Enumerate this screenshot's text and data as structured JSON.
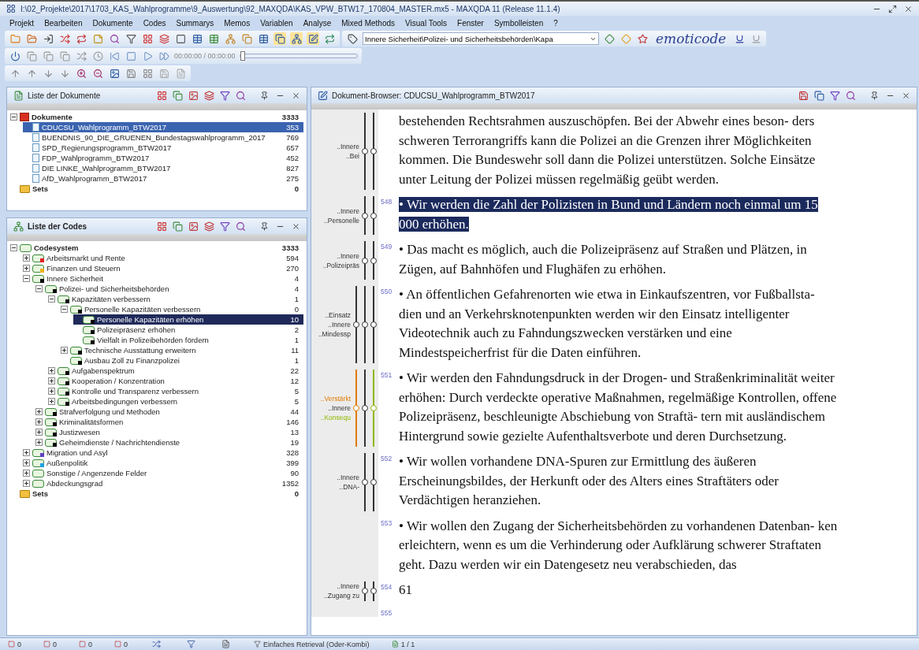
{
  "window": {
    "title": "I:\\02_Projekte\\2017\\1703_KAS_Wahlprogramme\\9_Auswertung\\92_MAXQDA\\KAS_VPW_BTW17_170804_MASTER.mx5 - MAXQDA 11 (Release 11.1.4)"
  },
  "menu": [
    "Projekt",
    "Bearbeiten",
    "Dokumente",
    "Codes",
    "Summarys",
    "Memos",
    "Variablen",
    "Analyse",
    "Mixed Methods",
    "Visual Tools",
    "Fenster",
    "Symbolleisten",
    "?"
  ],
  "toolbar": {
    "code_combo": "Innere Sicherheit\\Polizei- und Sicherheitsbehörden\\Kapa",
    "logo": "emoticode",
    "media_time": "00:00:00 / 00:00:00",
    "media_slider": {
      "level": 0
    }
  },
  "documents_panel": {
    "title": "Liste der Dokumente",
    "tree": [
      {
        "kind": "documents",
        "name": "Dokumente",
        "count": "3333",
        "expanded": true,
        "selected": false,
        "children": [
          {
            "kind": "document",
            "name": "CDUCSU_Wahlprogramm_BTW2017",
            "count": "353",
            "selected": true
          },
          {
            "kind": "document",
            "name": "BUENDNIS_90_DIE_GRUENEN_Bundestagswahlprogramm_2017",
            "count": "769",
            "selected": false
          },
          {
            "kind": "document",
            "name": "SPD_Regierungsprogramm_BTW2017",
            "count": "657",
            "selected": false
          },
          {
            "kind": "document",
            "name": "FDP_Wahlprogramm_BTW2017",
            "count": "452",
            "selected": false
          },
          {
            "kind": "document",
            "name": "DIE LINKE_Wahlprogramm_BTW2017",
            "count": "827",
            "selected": false
          },
          {
            "kind": "document",
            "name": "AfD_Wahlprogramm_BTW2017",
            "count": "275",
            "selected": false
          }
        ]
      },
      {
        "kind": "sets",
        "name": "Sets",
        "count": "0",
        "selected": false
      }
    ]
  },
  "codes_panel": {
    "title": "Liste der Codes",
    "tree": [
      {
        "kind": "codesystem",
        "name": "Codesystem",
        "count": "3333",
        "expanded": true,
        "selected": false,
        "children": [
          {
            "kind": "code",
            "name": "Arbeitsmarkt und Rente",
            "count": "594",
            "color": "#e02020",
            "expanded": false,
            "selected": false
          },
          {
            "kind": "code",
            "name": "Finanzen und Steuern",
            "count": "270",
            "color": "#f0b020",
            "expanded": false,
            "selected": false
          },
          {
            "kind": "code",
            "name": "Innere Sicherheit",
            "count": "4",
            "color": "#000000",
            "expanded": true,
            "selected": false,
            "children": [
              {
                "kind": "code",
                "name": "Polizei- und Sicherheitsbehörden",
                "count": "4",
                "color": "#000000",
                "expanded": true,
                "selected": false,
                "children": [
                  {
                    "kind": "code",
                    "name": "Kapazitäten verbessern",
                    "count": "1",
                    "color": "#000000",
                    "expanded": true,
                    "selected": false,
                    "children": [
                      {
                        "kind": "code",
                        "name": "Personelle Kapazitäten verbessern",
                        "count": "0",
                        "color": "#000000",
                        "expanded": true,
                        "selected": false,
                        "children": [
                          {
                            "kind": "code",
                            "name": "Personelle Kapazitäten erhöhen",
                            "count": "10",
                            "color": "#000000",
                            "selected": true
                          },
                          {
                            "kind": "code",
                            "name": "Polizeipräsenz erhöhen",
                            "count": "2",
                            "color": "#000000",
                            "selected": false
                          },
                          {
                            "kind": "code",
                            "name": "Vielfalt in Polizeibehörden fördern",
                            "count": "1",
                            "color": "#000000",
                            "selected": false
                          }
                        ]
                      },
                      {
                        "kind": "code",
                        "name": "Technische Ausstattung erweitern",
                        "count": "11",
                        "color": "#000000",
                        "expanded": false,
                        "selected": false
                      },
                      {
                        "kind": "code",
                        "name": "Ausbau Zoll zu Finanzpolizei",
                        "count": "1",
                        "color": "#000000",
                        "selected": false
                      }
                    ]
                  },
                  {
                    "kind": "code",
                    "name": "Aufgabenspektrum",
                    "count": "22",
                    "color": "#000000",
                    "expanded": false,
                    "selected": false
                  },
                  {
                    "kind": "code",
                    "name": "Kooperation / Konzentration",
                    "count": "12",
                    "color": "#000000",
                    "expanded": false,
                    "selected": false
                  },
                  {
                    "kind": "code",
                    "name": "Kontrolle und Transparenz verbessern",
                    "count": "5",
                    "color": "#000000",
                    "expanded": false,
                    "selected": false
                  },
                  {
                    "kind": "code",
                    "name": "Arbeitsbedingungen verbessern",
                    "count": "5",
                    "color": "#000000",
                    "expanded": false,
                    "selected": false
                  }
                ]
              },
              {
                "kind": "code",
                "name": "Strafverfolgung und Methoden",
                "count": "44",
                "color": "#000000",
                "expanded": false,
                "selected": false
              },
              {
                "kind": "code",
                "name": "Kriminalitätsformen",
                "count": "146",
                "color": "#000000",
                "expanded": false,
                "selected": false
              },
              {
                "kind": "code",
                "name": "Justizwesen",
                "count": "13",
                "color": "#000000",
                "expanded": false,
                "selected": false
              },
              {
                "kind": "code",
                "name": "Geheimdienste / Nachrichtendienste",
                "count": "19",
                "color": "#000000",
                "expanded": false,
                "selected": false
              }
            ]
          },
          {
            "kind": "code",
            "name": "Migration und Asyl",
            "count": "328",
            "color": "#6040c0",
            "expanded": false,
            "selected": false
          },
          {
            "kind": "code",
            "name": "Außenpolitik",
            "count": "399",
            "color": "#20a0e0",
            "expanded": false,
            "selected": false
          },
          {
            "kind": "code",
            "name": "Sonstige / Angenzende Felder",
            "count": "90",
            "expanded": false,
            "selected": false
          },
          {
            "kind": "code",
            "name": "Abdeckungsgrad",
            "count": "1352",
            "expanded": false,
            "selected": false
          }
        ]
      },
      {
        "kind": "sets",
        "name": "Sets",
        "count": "0",
        "selected": false
      }
    ]
  },
  "browser": {
    "title": "Dokument-Browser: CDUCSU_Wahlprogramm_BTW2017",
    "paragraphs": [
      {
        "selected": false,
        "codes": [
          {
            "text": "..Innere",
            "color": "#333333"
          },
          {
            "text": "..Bei",
            "color": "#333333"
          }
        ],
        "lines": [
          "bestehenden Rechtsrahmen auszuschöpfen. Bei der Abwehr eines beson- ders",
          "schweren Terrorangriffs kann die Polizei an die Grenzen ihrer Möglichkeiten",
          "kommen. Die Bundeswehr soll dann die Polizei unterstützen. Solche Einsätze",
          "unter Leitung der Polizei müssen regelmäßig geübt werden."
        ]
      },
      {
        "number": "548",
        "selected": true,
        "codes": [
          {
            "text": "..Innere",
            "color": "#333333"
          },
          {
            "text": "..Personelle",
            "color": "#333333"
          }
        ],
        "lines": [
          "• Wir werden die Zahl der Polizisten in Bund und Ländern noch einmal um 15",
          "000 erhöhen."
        ]
      },
      {
        "number": "549",
        "selected": false,
        "codes": [
          {
            "text": "..Innere",
            "color": "#333333"
          },
          {
            "text": "..Polizeipräs",
            "color": "#333333"
          }
        ],
        "lines": [
          "• Das macht es möglich, auch die Polizeipräsenz auf Straßen und Plätzen, in",
          "Zügen, auf Bahnhöfen und Flughäfen zu erhöhen."
        ]
      },
      {
        "number": "550",
        "selected": false,
        "codes": [
          {
            "text": "..Einsatz",
            "color": "#333333"
          },
          {
            "text": "..Innere",
            "color": "#333333"
          },
          {
            "text": "..Mindessp",
            "color": "#333333"
          }
        ],
        "lines": [
          "• An öffentlichen Gefahrenorten wie etwa in Einkaufszentren, vor Fußballsta-",
          "dien und an Verkehrsknotenpunkten werden wir den Einsatz intelligenter",
          "Videotechnik auch zu Fahndungszwecken verstärken und eine",
          "Mindestspeicherfrist für die Daten einführen."
        ]
      },
      {
        "number": "551",
        "selected": false,
        "codes": [
          {
            "text": "..Verstärkt",
            "color": "#e07b00"
          },
          {
            "text": "..Innere",
            "color": "#333333"
          },
          {
            "text": "..Konsequ",
            "color": "#8fb800"
          }
        ],
        "lines": [
          "• Wir werden den Fahndungsdruck in der Drogen- und Straßenkriminalität weiter",
          "erhöhen: Durch verdeckte operative Maßnahmen, regelmäßige Kontrollen, offene",
          "Polizeipräsenz, beschleunigte Abschiebung von Straftä- tern mit ausländischem",
          "Hintergrund sowie gezielte Aufenthaltsverbote und deren Durchsetzung."
        ]
      },
      {
        "number": "552",
        "selected": false,
        "codes": [
          {
            "text": "..Innere",
            "color": "#333333"
          },
          {
            "text": "..DNA-",
            "color": "#333333"
          }
        ],
        "lines": [
          "• Wir wollen vorhandene DNA-Spuren zur Ermittlung des äußeren",
          "Erscheinungsbildes, der Herkunft oder des Alters eines Straftäters oder",
          "Verdächtigen heranziehen."
        ]
      },
      {
        "number": "553",
        "selected": false,
        "lines": [
          "• Wir wollen den Zugang der Sicherheitsbehörden zu vorhandenen Datenban- ken",
          "erleichtern, wenn es um die Verhinderung oder Aufklärung schwerer Straftaten",
          "geht. Dazu werden wir ein Datengesetz neu verabschieden, das"
        ]
      },
      {
        "number": "554",
        "selected": false,
        "codes": [
          {
            "text": "..Innere",
            "color": "#333333"
          },
          {
            "text": "..Zugang zu",
            "color": "#333333"
          }
        ],
        "lines": [
          "61"
        ]
      },
      {
        "number": "555"
      }
    ]
  },
  "status_bar": {
    "counters": [
      "0",
      "0",
      "0",
      "0"
    ],
    "retrieval": "Einfaches Retrieval (Oder-Kombi)",
    "pages": "1 / 1"
  }
}
